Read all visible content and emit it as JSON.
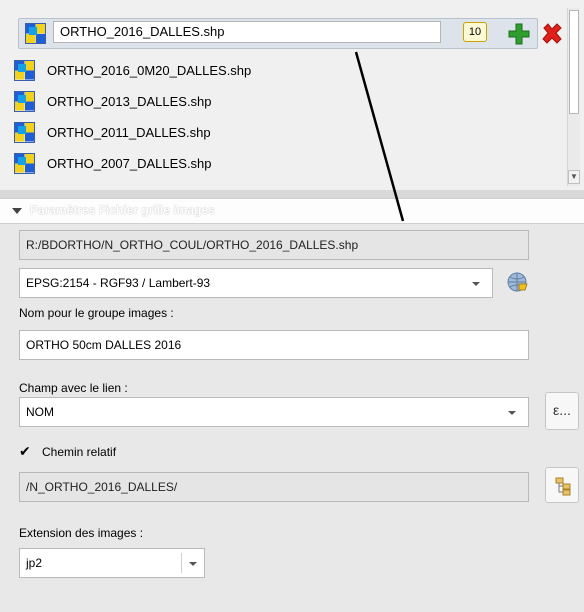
{
  "layer_list": {
    "selected": {
      "label": "ORTHO_2016_DALLES.shp",
      "count": "10"
    },
    "items": [
      "ORTHO_2016_0M20_DALLES.shp",
      "ORTHO_2013_DALLES.shp",
      "ORTHO_2011_DALLES.shp",
      "ORTHO_2007_DALLES.shp"
    ]
  },
  "params": {
    "title": "Paramètres Fichier grille images",
    "file_path": "R:/BDORTHO/N_ORTHO_COUL/ORTHO_2016_DALLES.shp",
    "crs_value": "EPSG:2154 - RGF93 / Lambert-93",
    "group_label": "Nom pour le groupe images :",
    "group_value": "ORTHO 50cm DALLES 2016",
    "field_label": "Champ avec le lien :",
    "field_value": "NOM",
    "expr_button": "ε...",
    "relative_checked": true,
    "relative_label": "Chemin relatif",
    "dir_value": "/N_ORTHO_2016_DALLES/",
    "ext_label": "Extension des images :",
    "ext_value": "jp2"
  },
  "colors": {
    "add": "#2e9e2e",
    "delete": "#e0201b"
  }
}
